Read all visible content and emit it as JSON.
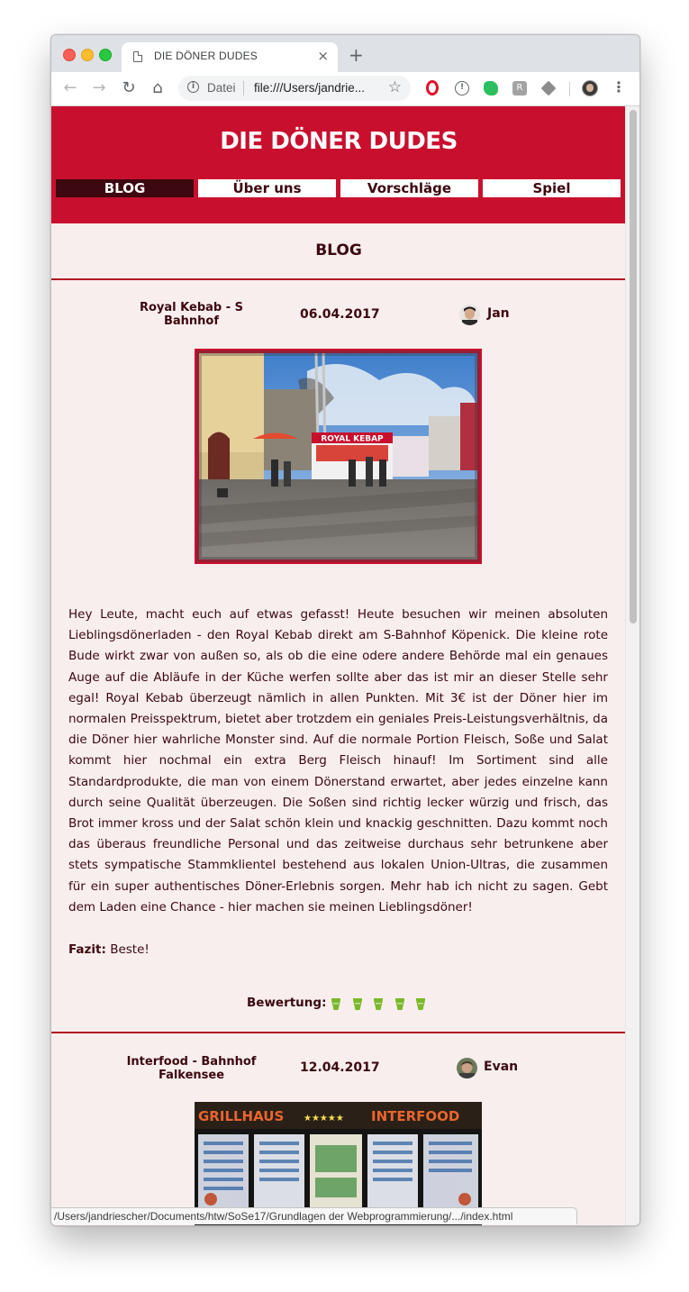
{
  "browser": {
    "tab_title": "DIE DÖNER DUDES",
    "tab_close": "×",
    "new_tab": "+",
    "omnibox_scheme": "Datei",
    "omnibox_url": "file:///Users/jandrie...",
    "status_bar_url": "/Users/jandriescher/Documents/htw/SoSe17/Grundlagen der Webprogrammierung/.../index.html",
    "extensions": [
      "opera-icon",
      "info-icon",
      "evernote-icon",
      "r-icon",
      "layers-icon"
    ],
    "ext_r_label": "R"
  },
  "site": {
    "title": "DIE DÖNER DUDES",
    "nav": [
      {
        "label": "BLOG",
        "active": true
      },
      {
        "label": "Über uns",
        "active": false
      },
      {
        "label": "Vorschläge",
        "active": false
      },
      {
        "label": "Spiel",
        "active": false
      }
    ],
    "section_heading": "BLOG",
    "colors": {
      "brand_red": "#c8102e",
      "dark_maroon": "#3d0810",
      "page_bg": "#f8eeee",
      "rating_green": "#7ab829"
    }
  },
  "posts": [
    {
      "title": "Royal Kebab - S Bahnhof",
      "date": "06.04.2017",
      "author": "Jan",
      "image_caption_sign": "ROYAL KEBAP",
      "body": "Hey Leute, macht euch auf etwas gefasst! Heute besuchen wir meinen absoluten Lieblingsdönerladen - den Royal Kebab direkt am S-Bahnhof Köpenick. Die kleine rote Bude wirkt zwar von außen so, als ob die eine odere andere Behörde mal ein genaues Auge auf die Abläufe in der Küche werfen sollte aber das ist mir an dieser Stelle sehr egal! Royal Kebab überzeugt nämlich in allen Punkten. Mit 3€ ist der Döner hier im normalen Preisspektrum, bietet aber trotzdem ein geniales Preis-Leistungsverhältnis, da die Döner hier wahrliche Monster sind. Auf die normale Portion Fleisch, Soße und Salat kommt hier nochmal ein extra Berg Fleisch hinauf! Im Sortiment sind alle Standardprodukte, die man von einem Dönerstand erwartet, aber jedes einzelne kann durch seine Qualität überzeugen. Die Soßen sind richtig lecker würzig und frisch, das Brot immer kross und der Salat schön klein und knackig geschnitten. Dazu kommt noch das überaus freundliche Personal und das zeitweise durchaus sehr betrunkene aber stets sympatische Stammklientel bestehend aus lokalen Union-Ultras, die zusammen für ein super authentisches Döner-Erlebnis sorgen. Mehr hab ich nicht zu sagen. Gebt dem Laden eine Chance - hier machen sie meinen Lieblingsdöner!",
      "verdict_label": "Fazit:",
      "verdict": "Beste!",
      "rating_label": "Bewertung:",
      "rating_value": 5,
      "rating_max": 5
    },
    {
      "title": "Interfood - Bahnhof Falkensee",
      "date": "12.04.2017",
      "author": "Evan",
      "image_sign_left": "GRILLHAUS",
      "image_sign_stars": "★★★★★",
      "image_sign_right": "INTERFOOD"
    }
  ]
}
